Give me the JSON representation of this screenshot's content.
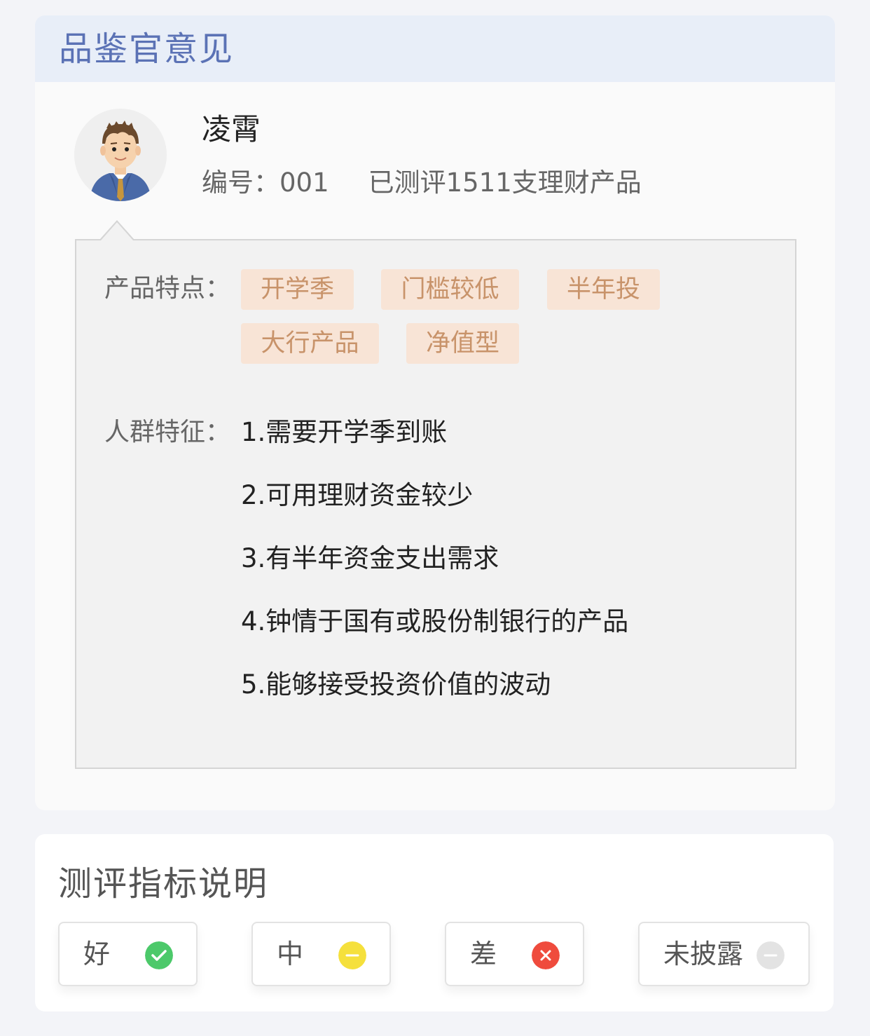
{
  "opinion_card": {
    "title": "品鉴官意见",
    "reviewer": {
      "name": "凌霄",
      "id_label": "编号：001",
      "count_label": "已测评1511支理财产品"
    },
    "product_features_label": "产品特点：",
    "product_tags": [
      "开学季",
      "门槛较低",
      "半年投",
      "大行产品",
      "净值型"
    ],
    "crowd_label": "人群特征：",
    "crowd_traits": [
      "1.需要开学季到账",
      "2.可用理财资金较少",
      "3.有半年资金支出需求",
      "4.钟情于国有或股份制银行的产品",
      "5.能够接受投资价值的波动"
    ]
  },
  "legend_card": {
    "title": "测评指标说明",
    "items": [
      {
        "label": "好",
        "icon": "check-icon",
        "color": "#4cc96a"
      },
      {
        "label": "中",
        "icon": "minus-icon",
        "color": "#f5e03c"
      },
      {
        "label": "差",
        "icon": "cross-icon",
        "color": "#ef4b3d"
      },
      {
        "label": "未披露",
        "icon": "minus-icon",
        "color": "#e3e3e3"
      }
    ]
  }
}
